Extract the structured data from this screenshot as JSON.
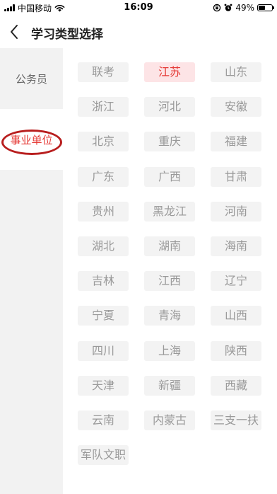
{
  "status_bar": {
    "carrier": "中国移动",
    "time": "16:09",
    "battery": "49%",
    "battery_level": 0.49
  },
  "header": {
    "title": "学习类型选择"
  },
  "sidebar": {
    "items": [
      {
        "label": "公务员",
        "active": false
      },
      {
        "label": "事业单位",
        "active": true
      }
    ]
  },
  "regions": {
    "selected": "江苏",
    "items": [
      "联考",
      "江苏",
      "山东",
      "浙江",
      "河北",
      "安徽",
      "北京",
      "重庆",
      "福建",
      "广东",
      "广西",
      "甘肃",
      "贵州",
      "黑龙江",
      "河南",
      "湖北",
      "湖南",
      "海南",
      "吉林",
      "江西",
      "辽宁",
      "宁夏",
      "青海",
      "山西",
      "四川",
      "上海",
      "陕西",
      "天津",
      "新疆",
      "西藏",
      "云南",
      "内蒙古",
      "三支一扶",
      "军队文职"
    ]
  },
  "colors": {
    "accent": "#e53935",
    "selected_bg": "#fde4e6",
    "chip_bg": "#f3f3f3",
    "chip_text": "#999999",
    "annotation_ring": "#b81e1e"
  }
}
